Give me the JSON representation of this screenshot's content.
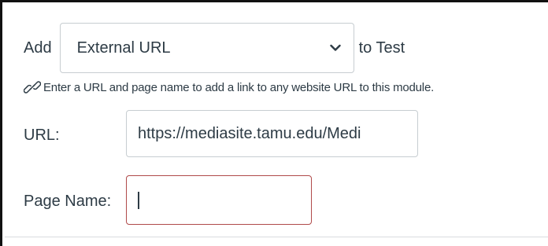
{
  "form": {
    "add_label": "Add",
    "select_value": "External URL",
    "to_label": "to Test",
    "help_text": "Enter a URL and page name to add a link to any website URL to this module.",
    "url_label": "URL:",
    "url_value": "https://mediasite.tamu.edu/Medi",
    "page_name_label": "Page Name:",
    "page_name_value": ""
  },
  "icons": {
    "select_chevron": "chevron-down-icon",
    "help": "link-icon"
  },
  "colors": {
    "text": "#2d3b45",
    "input_border": "#c7cdd1",
    "focused_input_border": "#b04a4a"
  }
}
